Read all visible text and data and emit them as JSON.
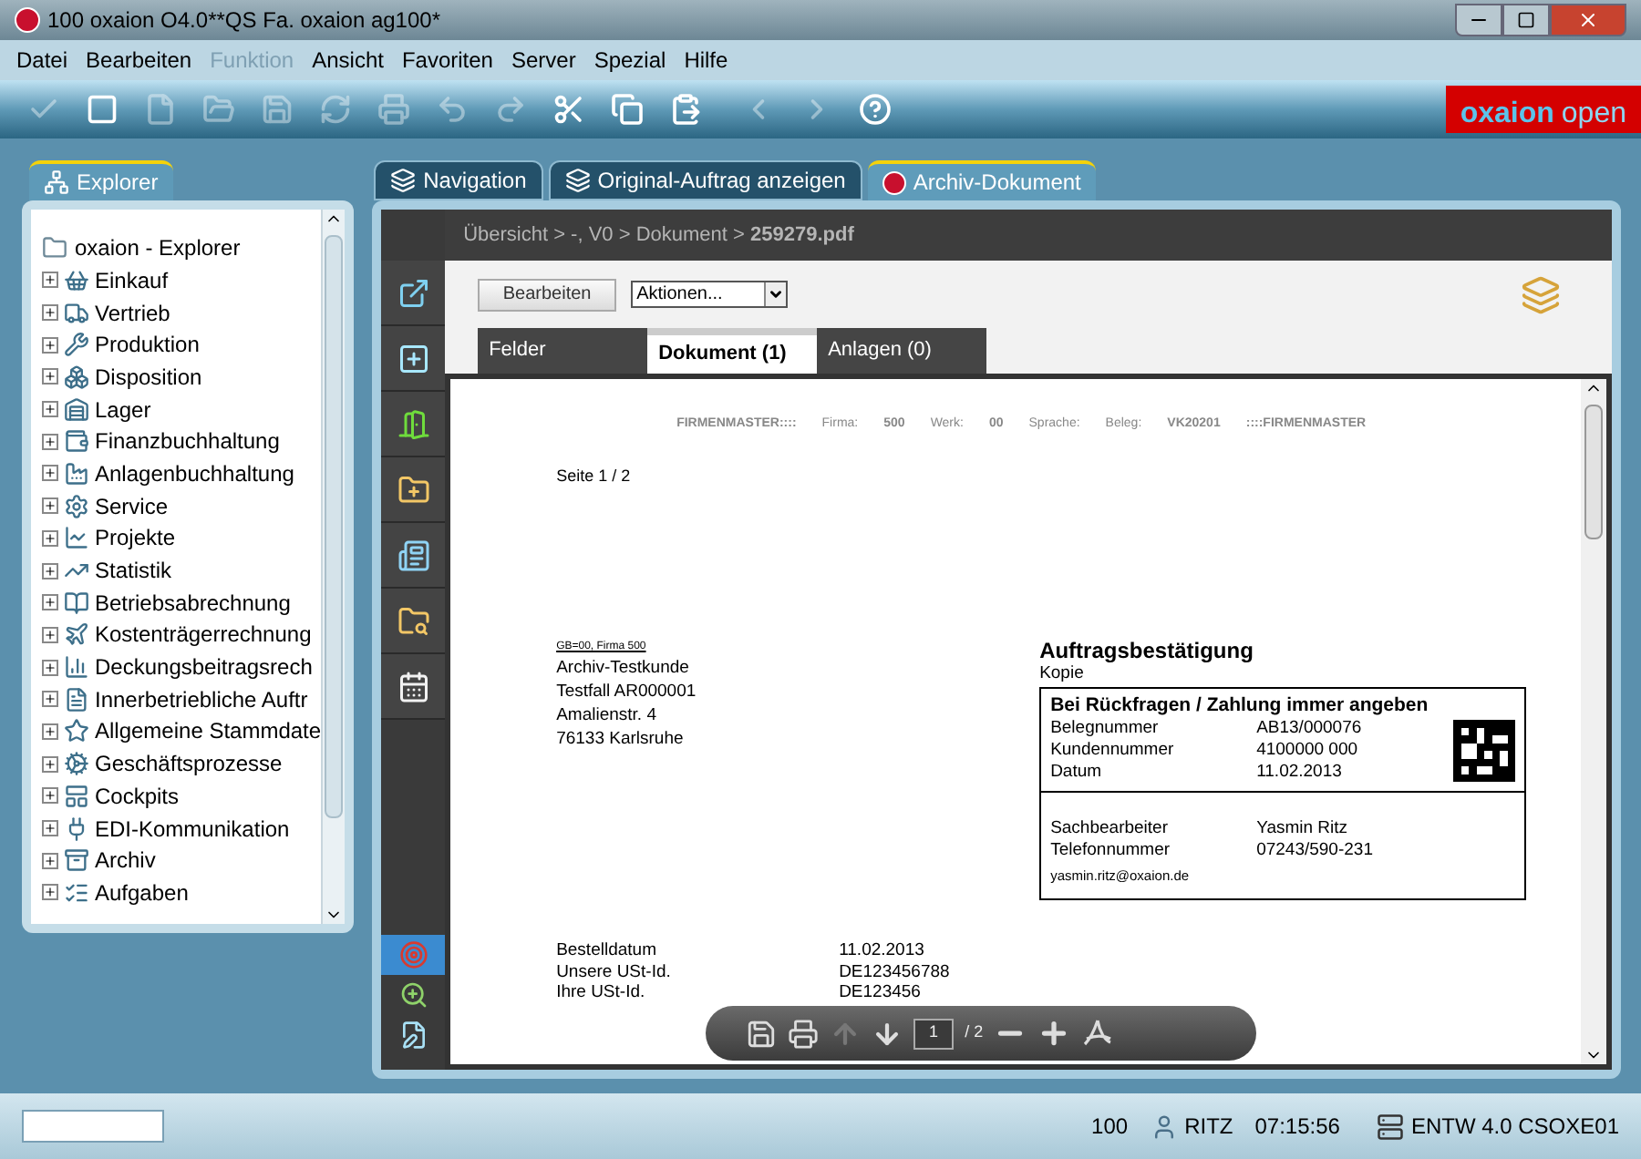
{
  "window": {
    "title": "100 oxaion  O4.0**QS Fa. oxaion ag100*"
  },
  "menu": [
    {
      "label": "Datei",
      "disabled": false
    },
    {
      "label": "Bearbeiten",
      "disabled": false
    },
    {
      "label": "Funktion",
      "disabled": true
    },
    {
      "label": "Ansicht",
      "disabled": false
    },
    {
      "label": "Favoriten",
      "disabled": false
    },
    {
      "label": "Server",
      "disabled": false
    },
    {
      "label": "Spezial",
      "disabled": false
    },
    {
      "label": "Hilfe",
      "disabled": false
    }
  ],
  "toolbar": [
    {
      "kind": "check",
      "disabled": true
    },
    {
      "kind": "stop",
      "disabled": false
    },
    {
      "kind": "new",
      "disabled": true
    },
    {
      "kind": "open",
      "disabled": true
    },
    {
      "kind": "save",
      "disabled": true
    },
    {
      "kind": "refresh",
      "disabled": true
    },
    {
      "kind": "print",
      "disabled": true
    },
    {
      "kind": "undo",
      "disabled": true
    },
    {
      "kind": "redo",
      "disabled": true
    },
    {
      "kind": "cut",
      "disabled": false
    },
    {
      "kind": "copy",
      "disabled": false
    },
    {
      "kind": "paste",
      "disabled": false
    },
    {
      "kind": "back",
      "disabled": true
    },
    {
      "kind": "forward",
      "disabled": true
    },
    {
      "kind": "help",
      "disabled": false
    }
  ],
  "logo": {
    "name": "oxaion",
    "suffix": "open"
  },
  "explorer": {
    "tab": "Explorer",
    "root": "oxaion - Explorer",
    "items": [
      {
        "label": "Einkauf",
        "expanded": false
      },
      {
        "label": "Vertrieb",
        "expanded": false
      },
      {
        "label": "Produktion",
        "expanded": false
      },
      {
        "label": "Disposition",
        "expanded": false
      },
      {
        "label": "Lager",
        "expanded": false
      },
      {
        "label": "Finanzbuchhaltung",
        "expanded": false
      },
      {
        "label": "Anlagenbuchhaltung",
        "expanded": false
      },
      {
        "label": "Service",
        "expanded": false
      },
      {
        "label": "Projekte",
        "expanded": false
      },
      {
        "label": "Statistik",
        "expanded": false
      },
      {
        "label": "Betriebsabrechnung",
        "expanded": false
      },
      {
        "label": "Kostenträgerrechnung",
        "expanded": false
      },
      {
        "label": "Deckungsbeitragsrech",
        "expanded": false
      },
      {
        "label": "Innerbetriebliche Auftr",
        "expanded": false
      },
      {
        "label": "Allgemeine Stammdate",
        "expanded": false
      },
      {
        "label": "Geschäftsprozesse",
        "expanded": false
      },
      {
        "label": "Cockpits",
        "expanded": false
      },
      {
        "label": "EDI-Kommunikation",
        "expanded": false
      },
      {
        "label": "Archiv",
        "expanded": false
      },
      {
        "label": "Aufgaben",
        "expanded": false
      }
    ]
  },
  "tabs": [
    {
      "label": "Navigation",
      "selected": false
    },
    {
      "label": "Original-Auftrag anzeigen",
      "selected": false
    },
    {
      "label": "Archiv-Dokument",
      "selected": true
    }
  ],
  "breadcrumb": "Übersicht > -, V0 > Dokument > **259279.pdf**",
  "actions": {
    "button": "Bearbeiten",
    "select": "Aktionen..."
  },
  "subtabs": [
    {
      "label": "Felder",
      "selected": false
    },
    {
      "label": "Dokument (1)",
      "selected": true
    },
    {
      "label": "Anlagen (0)",
      "selected": false
    }
  ],
  "document": {
    "header": [
      {
        "text": "FIRMENMASTER::::",
        "kind": "value"
      },
      {
        "text": "Firma:",
        "kind": "label"
      },
      {
        "text": "500",
        "kind": "value"
      },
      {
        "text": "Werk:",
        "kind": "label"
      },
      {
        "text": "00",
        "kind": "value"
      },
      {
        "text": "Sprache:",
        "kind": "label"
      },
      {
        "text": "Beleg:",
        "kind": "label"
      },
      {
        "text": "VK20201",
        "kind": "value"
      },
      {
        "text": "::::FIRMENMASTER",
        "kind": "value"
      }
    ],
    "page_label": "Seite 1 / 2",
    "sender_line": "GB=00, Firma 500",
    "address": [
      "Archiv-Testkunde",
      "Testfall AR000001",
      "Amalienstr. 4",
      "76133 Karlsruhe"
    ],
    "title": "Auftragsbestätigung",
    "subtitle": "Kopie",
    "box_heading": "Bei Rückfragen / Zahlung immer angeben",
    "box_rows": [
      {
        "label": "Belegnummer",
        "value": "AB13/000076"
      },
      {
        "label": "Kundennummer",
        "value": "4100000 000"
      },
      {
        "label": "Datum",
        "value": "11.02.2013"
      }
    ],
    "contact_rows": [
      {
        "label": "Sachbearbeiter",
        "value": "Yasmin Ritz"
      },
      {
        "label": "Telefonnummer",
        "value": "07243/590-231"
      }
    ],
    "email": "yasmin.ritz@oxaion.de",
    "order_rows": [
      {
        "label": "Bestelldatum",
        "value": "11.02.2013"
      },
      {
        "label": "Unsere USt-Id.",
        "value": "DE123456788"
      },
      {
        "label": "Ihre USt-Id.",
        "value": "DE123456"
      }
    ]
  },
  "pdf_toolbar": {
    "page": "1",
    "total": "/ 2"
  },
  "status_bar": {
    "company": "100",
    "user": "RITZ",
    "time": "07:15:56",
    "system": "ENTW 4.0 CSOXE01"
  }
}
